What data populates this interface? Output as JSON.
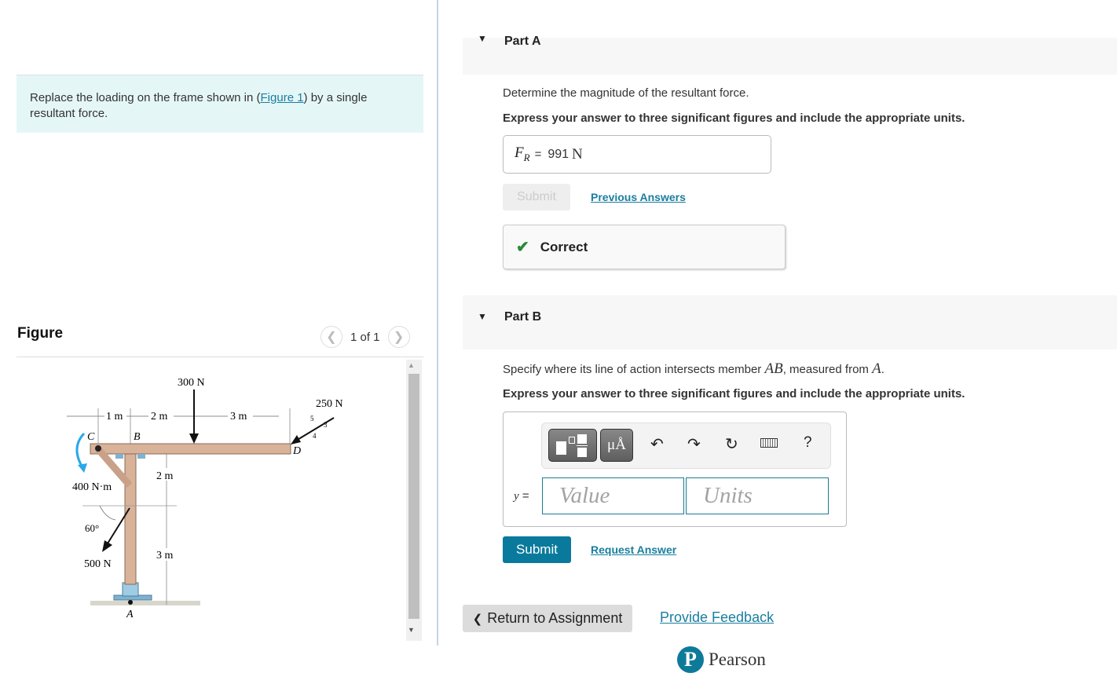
{
  "problem": {
    "text_before": "Replace the loading on the frame shown in (",
    "figure_link": "Figure 1",
    "text_after": ") by a single resultant force."
  },
  "figure": {
    "title": "Figure",
    "pager_text": "1 of 1",
    "prev_icon": "chevron-left-icon",
    "next_icon": "chevron-right-icon",
    "diagram": {
      "force_300": "300 N",
      "force_250": "250 N",
      "dim_1m": "1 m",
      "dim_2m_top": "2 m",
      "dim_3m_top": "3 m",
      "dim_2m_side": "2 m",
      "dim_3m_side": "3 m",
      "moment": "400 N·m",
      "angle": "60°",
      "force_500": "500 N",
      "slope_5": "5",
      "slope_3": "3",
      "slope_4": "4",
      "point_a": "A",
      "point_b": "B",
      "point_c": "C",
      "point_d": "D"
    }
  },
  "part_a": {
    "label": "Part A",
    "question": "Determine the magnitude of the resultant force.",
    "instruction": "Express your answer to three significant figures and include the appropriate units.",
    "answer_var": "F",
    "answer_sub": "R",
    "answer_eq": "=",
    "answer_value": "991",
    "answer_unit": "N",
    "submit_label": "Submit",
    "previous_answers_label": "Previous Answers",
    "feedback_label": "Correct"
  },
  "part_b": {
    "label": "Part B",
    "question_before": "Specify where its line of action intersects member ",
    "question_var1": "AB",
    "question_mid": ", measured from ",
    "question_var2": "A",
    "question_end": ".",
    "instruction": "Express your answer to three significant figures and include the appropriate units.",
    "toolbar": {
      "units_button": "μÅ",
      "help": "?"
    },
    "var_label": "y",
    "eq": "=",
    "value_placeholder": "Value",
    "units_placeholder": "Units",
    "submit_label": "Submit",
    "request_answer_label": "Request Answer"
  },
  "footer": {
    "return_label": "Return to Assignment",
    "feedback_label": "Provide Feedback",
    "brand": "Pearson"
  },
  "colors": {
    "accent": "#0a7a9c",
    "link": "#1a7ea0",
    "correct": "#2a8a3a",
    "problem_bg": "#e5f6f7"
  }
}
